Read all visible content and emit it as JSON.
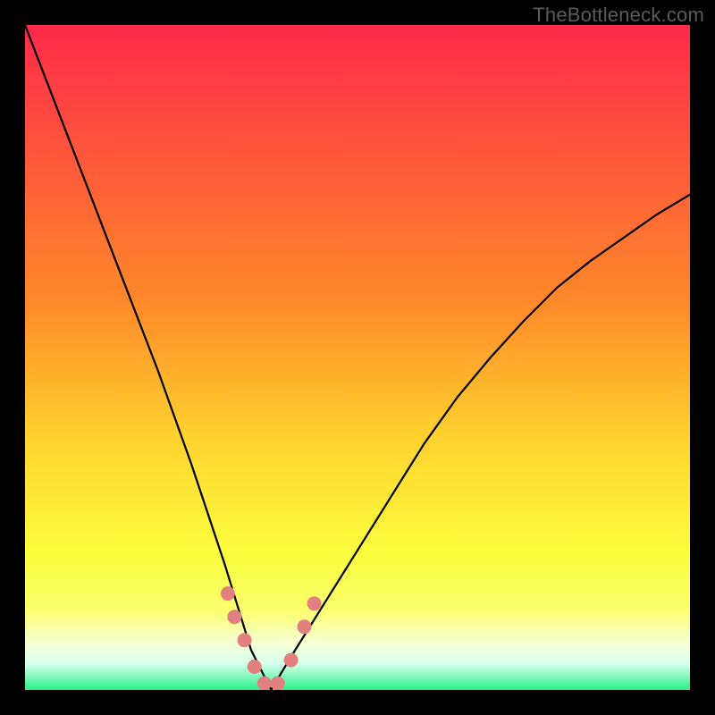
{
  "watermark": "TheBottleneck.com",
  "colors": {
    "frame": "#000000",
    "gradient_top": "#fd2a4a",
    "gradient_mid": "#ffd22e",
    "gradient_band_yellow": "#fbff6e",
    "gradient_band_pale": "#f5ffd5",
    "gradient_bottom": "#29f188",
    "curve": "#000000",
    "marker": "#e28080",
    "watermark": "#5b5b5b"
  },
  "chart_data": {
    "type": "line",
    "title": "",
    "xlabel": "",
    "ylabel": "",
    "xlim": [
      0,
      1
    ],
    "ylim": [
      0,
      1
    ],
    "grid": false,
    "legend": false,
    "x_at_min": 0.37,
    "series": [
      {
        "name": "bottleneck-curve",
        "x": [
          0.0,
          0.05,
          0.1,
          0.15,
          0.2,
          0.25,
          0.3,
          0.34,
          0.37,
          0.4,
          0.45,
          0.5,
          0.55,
          0.6,
          0.65,
          0.7,
          0.75,
          0.8,
          0.85,
          0.9,
          0.95,
          1.0
        ],
        "y": [
          1.0,
          0.87,
          0.74,
          0.61,
          0.48,
          0.34,
          0.19,
          0.06,
          0.0,
          0.05,
          0.13,
          0.21,
          0.29,
          0.37,
          0.44,
          0.5,
          0.555,
          0.605,
          0.645,
          0.68,
          0.715,
          0.745
        ]
      }
    ],
    "highlight_zone": {
      "from_x": 0.3,
      "to_x": 0.44
    },
    "markers": {
      "x": [
        0.305,
        0.315,
        0.33,
        0.345,
        0.36,
        0.38,
        0.4,
        0.42,
        0.435
      ],
      "y": [
        0.145,
        0.11,
        0.075,
        0.035,
        0.01,
        0.01,
        0.045,
        0.095,
        0.13
      ]
    }
  }
}
